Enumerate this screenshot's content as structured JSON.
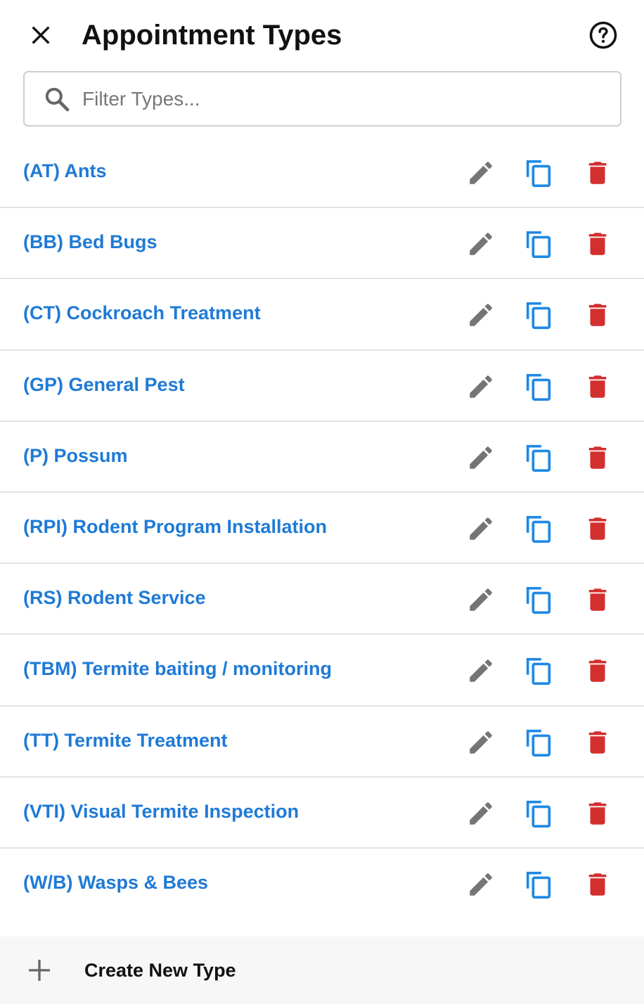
{
  "header": {
    "title": "Appointment Types",
    "close_icon": "close-icon",
    "help_icon": "help-circle-icon"
  },
  "filter": {
    "placeholder": "Filter Types...",
    "value": "",
    "icon": "search-icon"
  },
  "colors": {
    "link": "#1f7ad6",
    "edit": "#757575",
    "copy": "#1e88e5",
    "delete": "#d32f2f",
    "footer_bg": "#f7f7f7"
  },
  "types": [
    {
      "label": "(AT) Ants"
    },
    {
      "label": "(BB) Bed Bugs"
    },
    {
      "label": "(CT) Cockroach Treatment"
    },
    {
      "label": "(GP) General Pest"
    },
    {
      "label": "(P) Possum"
    },
    {
      "label": "(RPI) Rodent Program Installation"
    },
    {
      "label": "(RS) Rodent Service"
    },
    {
      "label": "(TBM) Termite baiting / monitoring"
    },
    {
      "label": "(TT) Termite Treatment"
    },
    {
      "label": "(VTI) Visual Termite Inspection"
    },
    {
      "label": "(W/B) Wasps & Bees"
    }
  ],
  "row_actions": [
    "edit-icon",
    "copy-icon",
    "delete-icon"
  ],
  "footer": {
    "create_label": "Create New Type",
    "icon": "plus-icon"
  }
}
